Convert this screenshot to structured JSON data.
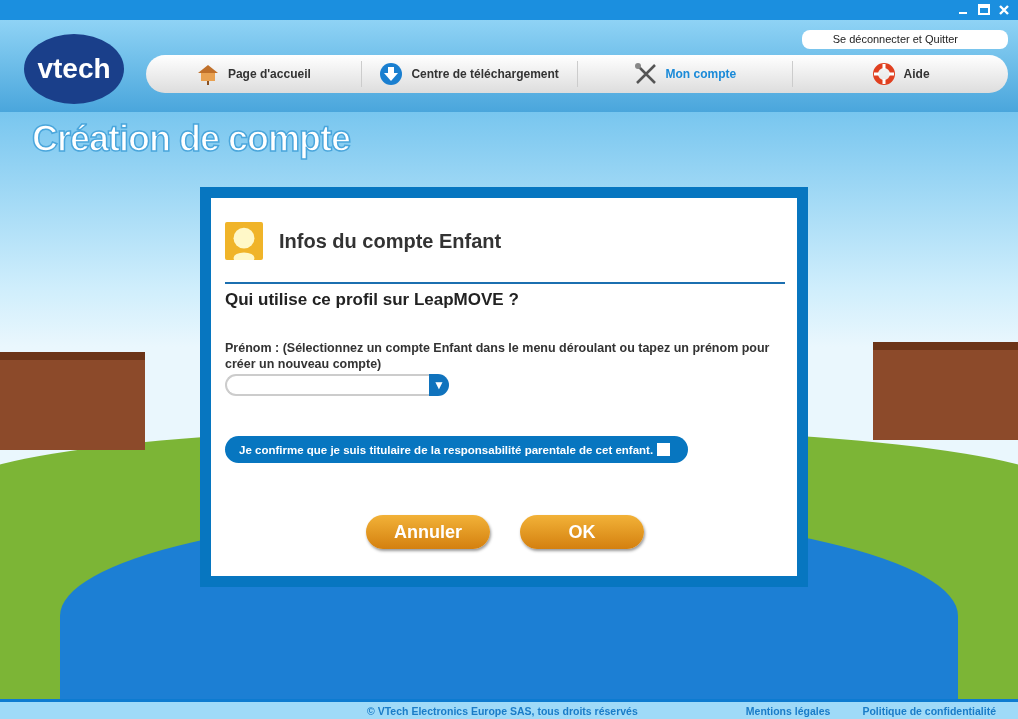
{
  "header": {
    "logo": "vtech",
    "account_link": "Se déconnecter et Quitter",
    "nav": [
      {
        "label": "Page d'accueil",
        "selected": false
      },
      {
        "label": "Centre de téléchargement",
        "selected": false
      },
      {
        "label": "Mon compte",
        "selected": true
      },
      {
        "label": "Aide",
        "selected": false
      }
    ]
  },
  "page_title": "Création de compte",
  "dialog": {
    "title": "Infos du compte Enfant",
    "question": "Qui utilise ce profil sur LeapMOVE ?",
    "field_label": "Prénom : (Sélectionnez un compte Enfant dans le menu déroulant ou tapez un prénom pour créer un nouveau compte)",
    "dropdown_arrow": "▼",
    "confirm": {
      "label": "Je confirme que je suis titulaire de la responsabilité parentale de cet enfant.",
      "checked": false
    },
    "buttons": [
      "Annuler",
      "OK"
    ]
  },
  "footer": {
    "copyright": "© VTech Electronics Europe SAS, tous droits réservés",
    "links": [
      "Mentions légales",
      "Politique de confidentialité"
    ]
  }
}
